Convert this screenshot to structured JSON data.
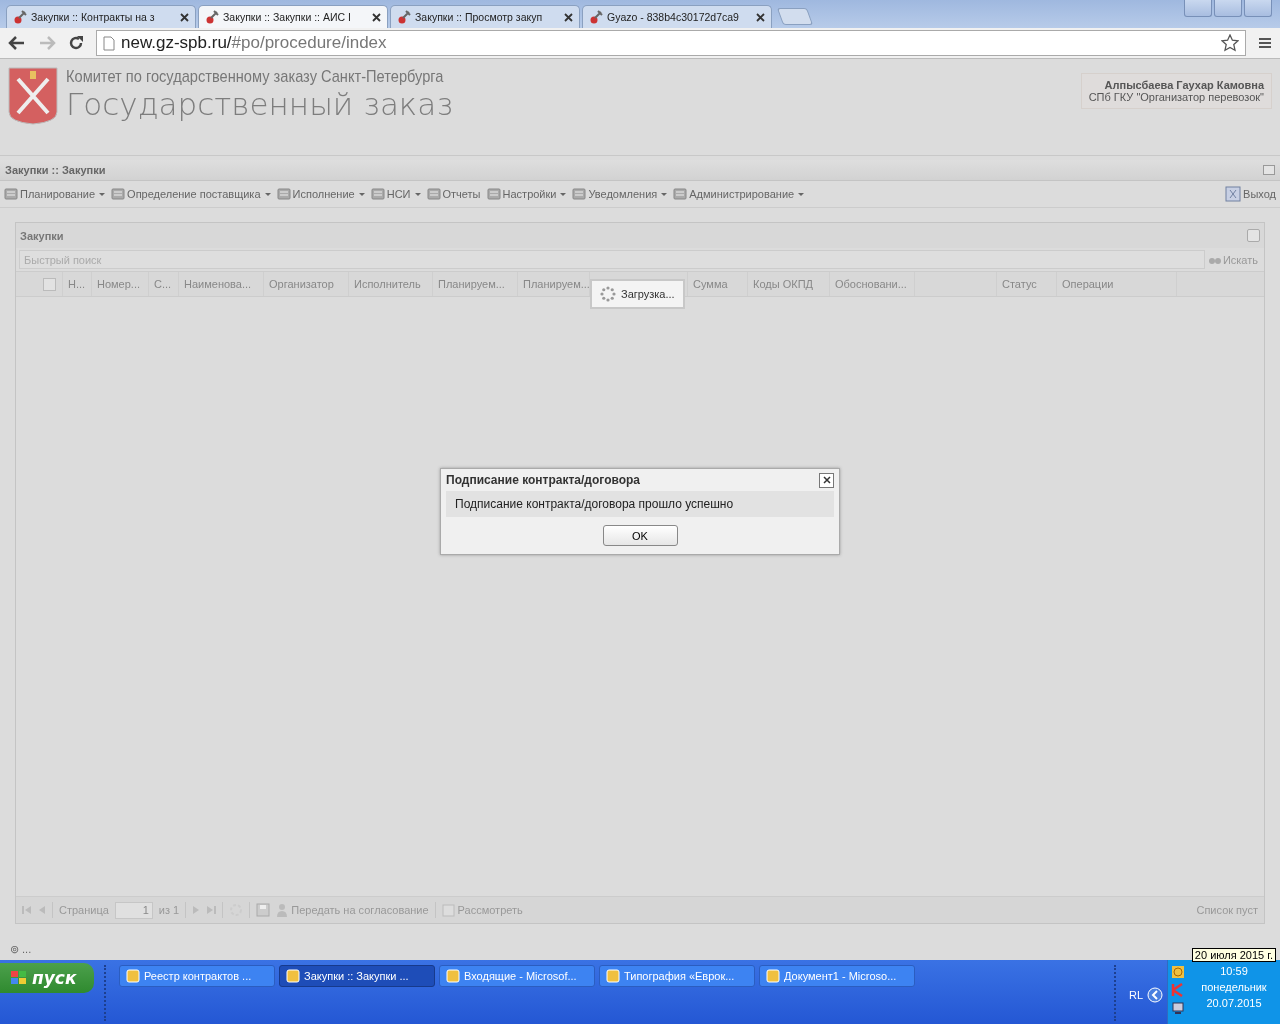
{
  "browser": {
    "tabs": [
      {
        "title": "Закупки :: Контракты на з",
        "selected": false
      },
      {
        "title": "Закупки :: Закупки :: АИС I",
        "selected": true
      },
      {
        "title": "Закупки :: Просмотр закуп",
        "selected": false
      },
      {
        "title": "Gyazo - 838b4c30172d7ca9",
        "selected": false
      }
    ],
    "url_host": "new.gz-spb.ru/",
    "url_path": "#po/procedure/index"
  },
  "header": {
    "org": "Комитет по государственному заказу Санкт-Петербурга",
    "title": "Государственный заказ",
    "user_name": "Алпысбаева Гаухар Камовна",
    "user_org": "СПб ГКУ \"Организатор перевозок\""
  },
  "panel_title": "Закупки :: Закупки",
  "menu": [
    {
      "label": "Планирование",
      "dropdown": true
    },
    {
      "label": "Определение поставщика",
      "dropdown": true
    },
    {
      "label": "Исполнение",
      "dropdown": true
    },
    {
      "label": "НСИ",
      "dropdown": true
    },
    {
      "label": "Отчеты",
      "dropdown": false
    },
    {
      "label": "Настройки",
      "dropdown": true
    },
    {
      "label": "Уведомления",
      "dropdown": true
    },
    {
      "label": "Администрирование",
      "dropdown": true
    }
  ],
  "logout": "Выход",
  "grid": {
    "title": "Закупки",
    "select_all_checked": false,
    "search_placeholder": "Быстрый поиск",
    "search_button": "Искать",
    "columns": [
      "Н...",
      "Номер...",
      "С...",
      "Наименова...",
      "Организатор",
      "Исполнитель",
      "Планируем...",
      "Планируем...",
      "",
      "Сумма",
      "Коды ОКПД",
      "Обосновани...",
      "",
      "Статус",
      "Операции"
    ],
    "loading": "Загрузка...",
    "paging": {
      "page_label": "Страница",
      "page": "1",
      "of": "из 1",
      "send": "Передать на согласование",
      "review": "Рассмотреть",
      "empty": "Список пуст"
    }
  },
  "status": "⊚ ...",
  "dialog": {
    "title": "Подписание контракта/договора",
    "message": "Подписание контракта/договора прошло успешно",
    "ok": "OK"
  },
  "taskbar": {
    "start": "пуск",
    "tasks": [
      {
        "label": "Реестр контрактов ...",
        "selected": false
      },
      {
        "label": "Закупки :: Закупки ...",
        "selected": true
      },
      {
        "label": "Входящие - Microsof...",
        "selected": false
      },
      {
        "label": "Типография «Еврок...",
        "selected": false
      },
      {
        "label": "Документ1 - Microso...",
        "selected": false
      }
    ],
    "lang": "RL",
    "time": "10:59",
    "weekday": "понедельник",
    "date": "20.07.2015",
    "tooltip": "20 июля 2015 г."
  }
}
